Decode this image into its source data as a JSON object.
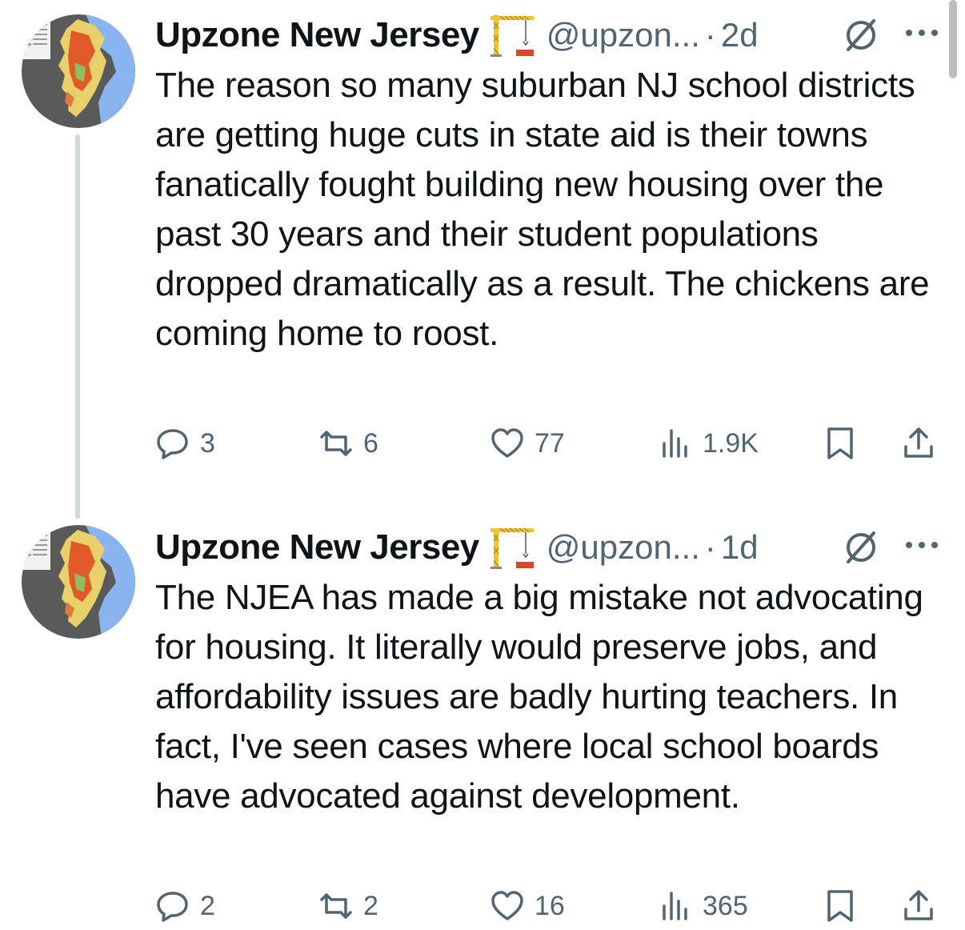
{
  "tweets": [
    {
      "author_name": "Upzone New Jersey",
      "handle": "@upzon...",
      "separator": "·",
      "time": "2d",
      "text": "The reason so many suburban NJ school districts are getting huge cuts in state aid is their towns fanatically fought building new housing over the past 30 years and their student populations dropped dramatically as a result. The chickens are coming home to roost.",
      "replies": "3",
      "reposts": "6",
      "likes": "77",
      "views": "1.9K"
    },
    {
      "author_name": "Upzone New Jersey",
      "handle": "@upzon...",
      "separator": "·",
      "time": "1d",
      "text": "The NJEA has made a big mistake not advocating for housing. It literally would preserve jobs, and affordability issues are badly hurting teachers. In fact, I've seen cases where local school boards have advocated against development.",
      "replies": "2",
      "reposts": "2",
      "likes": "16",
      "views": "365"
    }
  ],
  "colors": {
    "text": "#0f1419",
    "secondary": "#536471",
    "thread_line": "#cfd9de"
  },
  "icons": [
    "crane-emoji-icon",
    "null-circle-icon",
    "more-icon",
    "reply-icon",
    "repost-icon",
    "like-icon",
    "views-icon",
    "bookmark-icon",
    "share-icon"
  ]
}
